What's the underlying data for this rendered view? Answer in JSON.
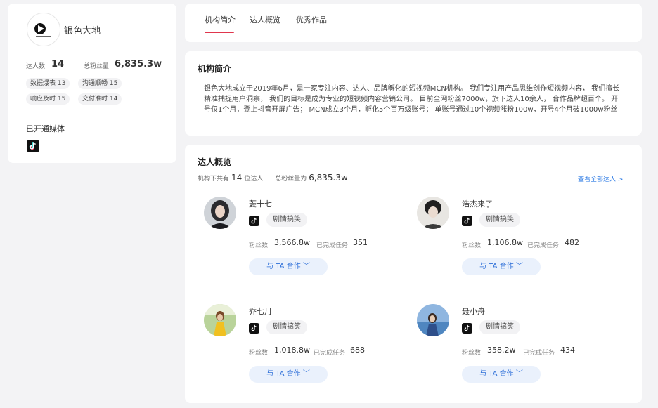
{
  "org": {
    "name": "银色大地",
    "stats": [
      {
        "label": "达人数",
        "value": "14"
      },
      {
        "label": "总粉丝量",
        "value": "6,835.3w"
      }
    ],
    "tags": [
      "数据爆表 13",
      "沟通顺畅 15",
      "响应及时 15",
      "交付准时 14"
    ],
    "media_title": "已开通媒体",
    "media_icons": [
      "tiktok-icon"
    ]
  },
  "tabs": [
    {
      "label": "机构简介",
      "active": true
    },
    {
      "label": "达人概览",
      "active": false
    },
    {
      "label": "优秀作品",
      "active": false
    }
  ],
  "intro": {
    "title": "机构简介",
    "text": "银色大地成立于2019年6月，是一家专注内容、达人、品牌孵化的短视频MCN机构。 我们专注用产品思维创作短视频内容， 我们擅长精准捕捉用户洞察， 我们的目标是成为专业的短视频内容营销公司。 目前全网粉丝7000w，旗下达人10余人， 合作品牌超百个。 开号仅1个月，登上抖音开屏广告； MCN成立3个月，孵化5个百万级账号； 单账号通过10个视频涨粉100w，开号4个月破1000w粉丝"
  },
  "overview": {
    "title": "达人概览",
    "summary_prefix": "机构下共有",
    "summary_count": "14",
    "summary_unit": "位达人",
    "summary_fans_label": "总粉丝量为",
    "summary_fans": "6,835.3w",
    "view_all": "查看全部达人 >",
    "fans_label": "粉丝数",
    "task_label": "已完成任务",
    "coop_label": "与 TA 合作 ﹀",
    "talents": [
      {
        "name": "菱十七",
        "tag": "剧情搞笑",
        "fans": "3,566.8w",
        "tasks": "351"
      },
      {
        "name": "浩杰来了",
        "tag": "剧情搞笑",
        "fans": "1,106.8w",
        "tasks": "482"
      },
      {
        "name": "乔七月",
        "tag": "剧情搞笑",
        "fans": "1,018.8w",
        "tasks": "688"
      },
      {
        "name": "聂小舟",
        "tag": "剧情搞笑",
        "fans": "358.2w",
        "tasks": "434"
      }
    ]
  },
  "colors": {
    "accent": "#e0364d",
    "link": "#2d7be5",
    "button_bg": "#eaf1fc",
    "button_text": "#2d6fd8"
  }
}
